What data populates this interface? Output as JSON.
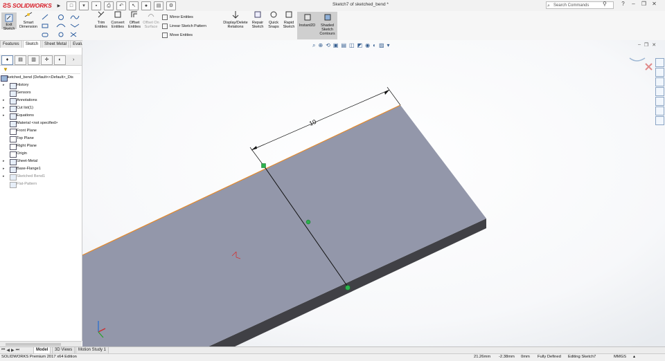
{
  "app": {
    "name": "SOLIDWORKS",
    "document_title": "Sketch7 of sketched_bend *"
  },
  "search": {
    "placeholder": "Search Commands"
  },
  "ribbon": {
    "exit_sketch": "Exit Sketch",
    "smart_dimension": "Smart Dimension",
    "trim_entities": "Trim Entities",
    "convert_entities": "Convert Entities",
    "offset_entities": "Offset Entities",
    "offset_on_surface": "Offset On Surface",
    "mirror_entities": "Mirror Entities",
    "linear_sketch_pattern": "Linear Sketch Pattern",
    "move_entities": "Move Entities",
    "display_delete_relations": "Display/Delete Relations",
    "repair_sketch": "Repair Sketch",
    "quick_snaps": "Quick Snaps",
    "rapid_sketch": "Rapid Sketch",
    "instant2d": "Instant2D",
    "shaded_sketch_contours": "Shaded Sketch Contours"
  },
  "tabs": [
    "Features",
    "Sketch",
    "Sheet Metal",
    "Evaluate"
  ],
  "tree": {
    "root": "sketched_bend  (Default<<Default>_Dis",
    "items": [
      {
        "label": "History",
        "expand": true
      },
      {
        "label": "Sensors",
        "expand": false
      },
      {
        "label": "Annotations",
        "expand": true
      },
      {
        "label": "Cut list(1)",
        "expand": true
      },
      {
        "label": "Equations",
        "expand": true
      },
      {
        "label": "Material <not specified>",
        "expand": false
      },
      {
        "label": "Front Plane",
        "expand": false
      },
      {
        "label": "Top Plane",
        "expand": false
      },
      {
        "label": "Right Plane",
        "expand": false
      },
      {
        "label": "Origin",
        "expand": false
      },
      {
        "label": "Sheet-Metal",
        "expand": true
      },
      {
        "label": "Base-Flange1",
        "expand": true
      },
      {
        "label": "Sketched Bend1",
        "expand": true
      },
      {
        "label": "Flat-Pattern",
        "expand": false
      }
    ]
  },
  "dimension": {
    "value": "10"
  },
  "bottom_tabs": [
    "Model",
    "3D Views",
    "Motion Study 1"
  ],
  "status": {
    "edition": "SOLIDWORKS Premium 2017 x64 Edition",
    "x": "21.26mm",
    "y": "-2.38mm",
    "z": "0mm",
    "state": "Fully Defined",
    "editing": "Editing Sketch7",
    "units": "MMGS"
  },
  "colors": {
    "sheet_top": "#9397aa",
    "sheet_edge": "#404045",
    "highlight_edge": "#e5892a",
    "point": "#2bb24c"
  }
}
